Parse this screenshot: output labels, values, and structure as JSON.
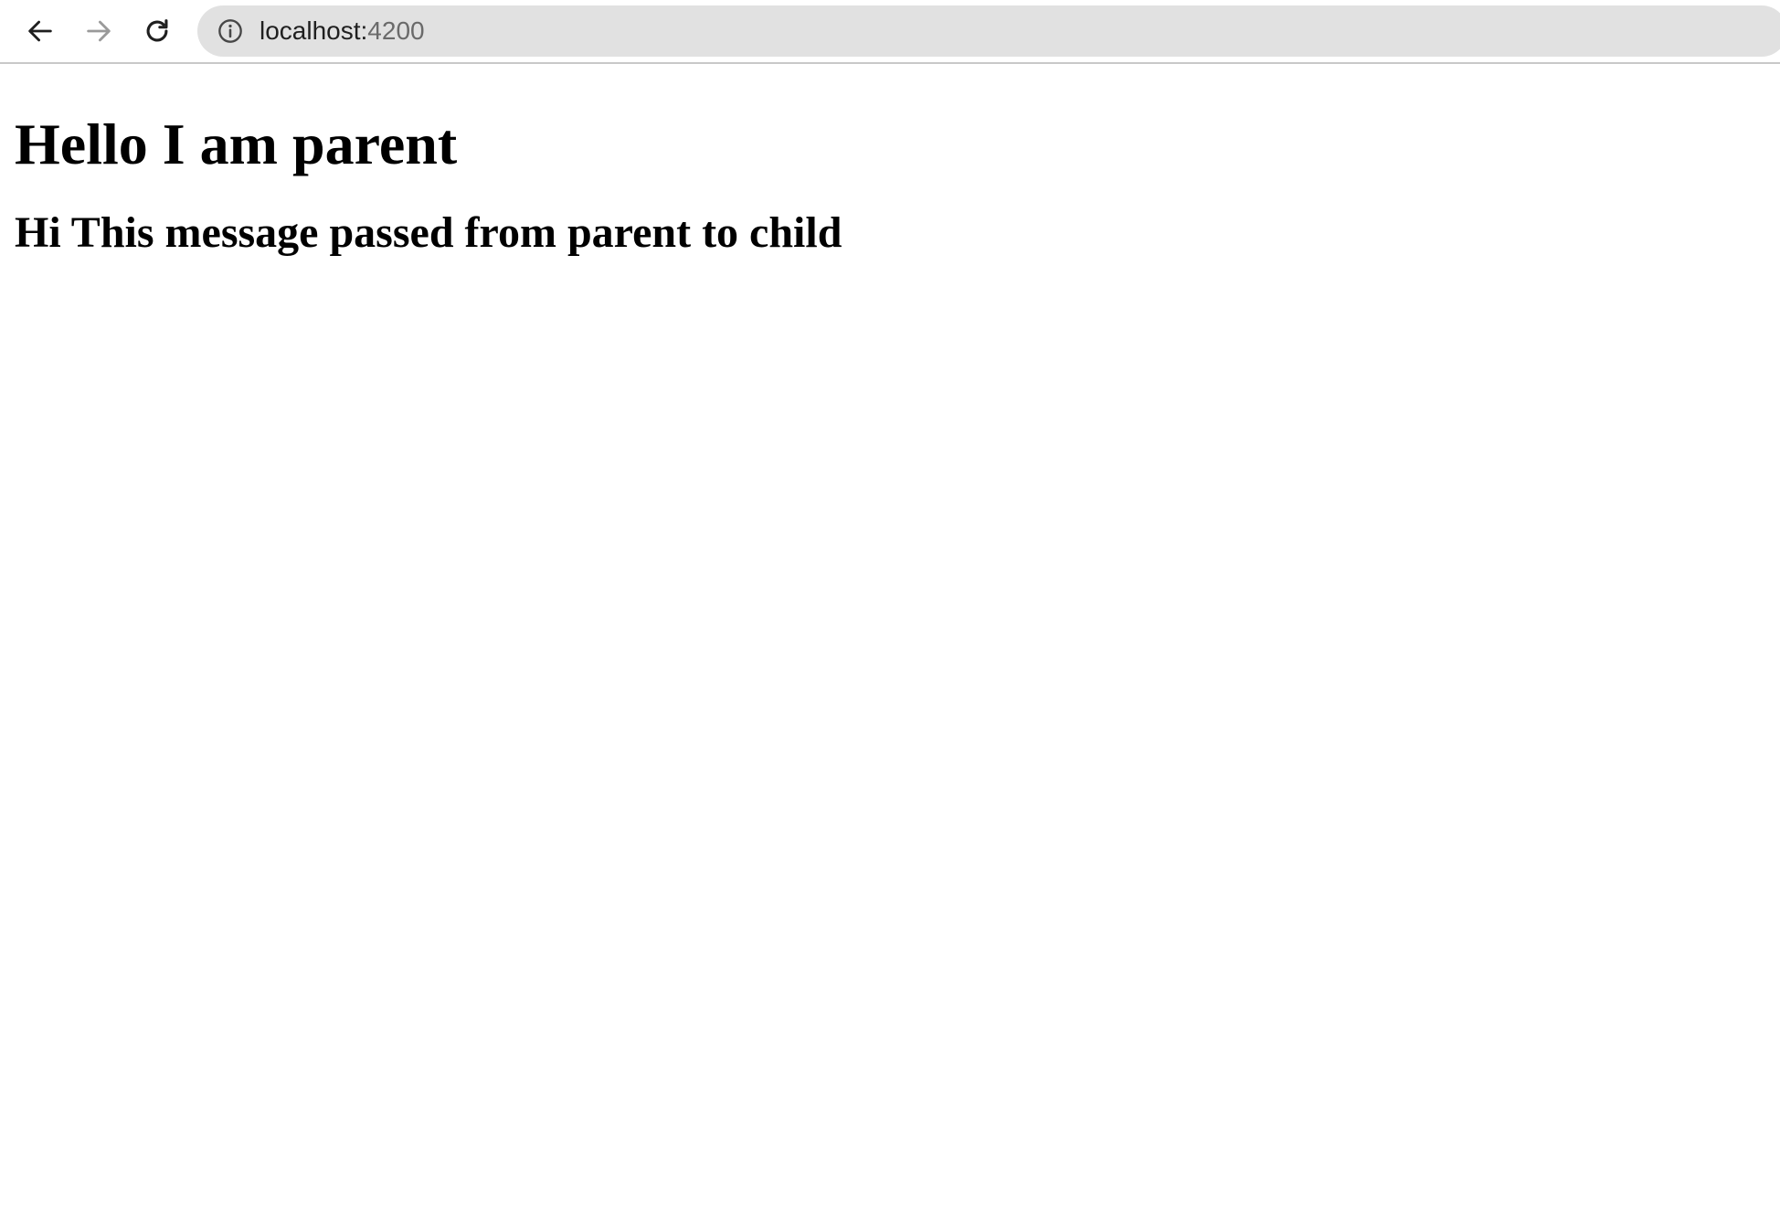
{
  "browser": {
    "address_bar": {
      "host": "localhost:",
      "port": "4200"
    },
    "icons": {
      "back": "back-arrow-icon",
      "forward": "forward-arrow-icon",
      "reload": "reload-icon",
      "site_info": "info-icon"
    }
  },
  "page": {
    "title": "Hello I am parent",
    "child_message": "Hi This message passed from parent to child"
  }
}
